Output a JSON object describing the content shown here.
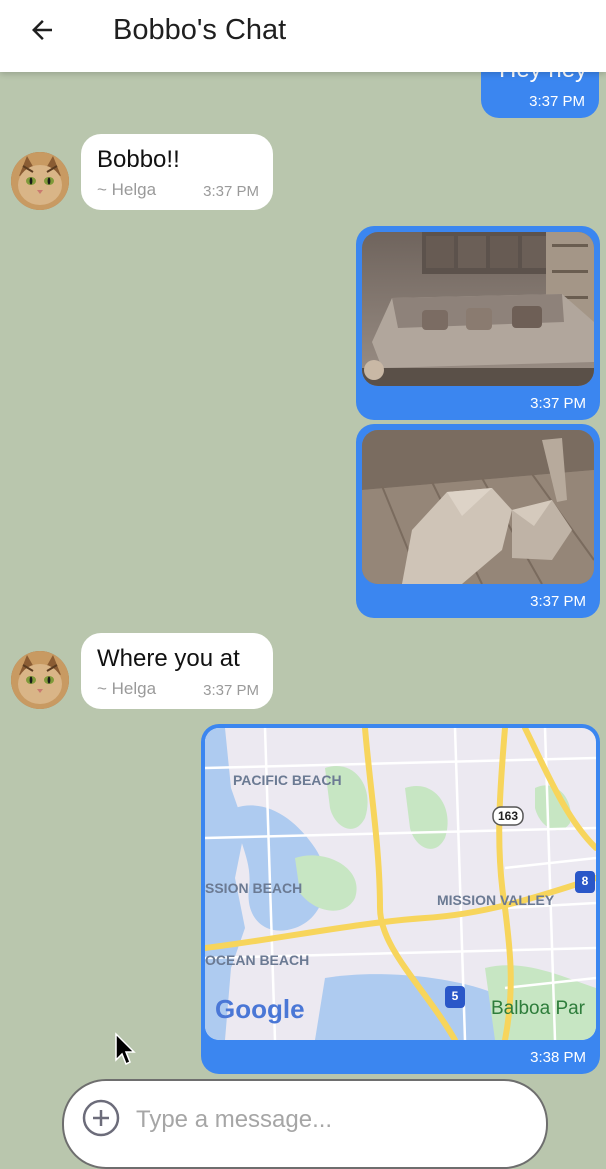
{
  "header": {
    "title": "Bobbo's Chat"
  },
  "messages": [
    {
      "type": "text-out-partial",
      "text": "Hey hey",
      "time": "3:37 PM"
    },
    {
      "type": "text-in",
      "text": "Bobbo!!",
      "author": "~ Helga",
      "time": "3:37 PM"
    },
    {
      "type": "image-out",
      "subject": "living room with sofa",
      "time": "3:37 PM"
    },
    {
      "type": "image-out",
      "subject": "low-poly dog on wooden floor",
      "time": "3:37 PM"
    },
    {
      "type": "text-in",
      "text": "Where you at",
      "author": "~ Helga",
      "time": "3:37 PM"
    },
    {
      "type": "map-out",
      "time": "3:38 PM",
      "map": {
        "labels": [
          "PACIFIC BEACH",
          "SSION BEACH",
          "OCEAN BEACH",
          "MISSION VALLEY",
          "Balboa Par"
        ],
        "shields": [
          "163",
          "8",
          "5"
        ],
        "attribution": "Google"
      }
    }
  ],
  "composer": {
    "placeholder": "Type a message..."
  },
  "colors": {
    "background": "#b9c6ad",
    "outgoing": "#3b86f0",
    "incoming": "#ffffff"
  }
}
